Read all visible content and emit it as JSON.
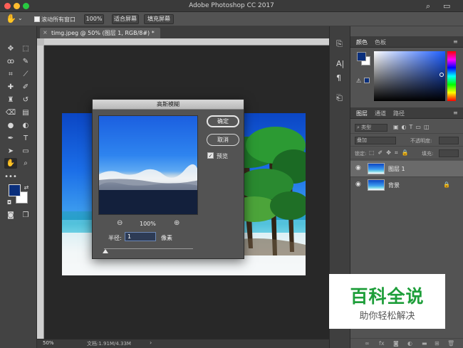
{
  "app": {
    "title": "Adobe Photoshop CC 2017"
  },
  "options": {
    "scroll_all_label": "滚动所有窗口",
    "zoom_100": "100%",
    "fit_screen": "适合屏幕",
    "fill_screen": "填充屏幕"
  },
  "document": {
    "tab_label": "timg.jpeg @ 50% (图层 1, RGB/8#) *",
    "zoom": "50%",
    "doc_size": "文档:1.91M/4.33M"
  },
  "dialog": {
    "title": "高斯模糊",
    "ok": "确定",
    "cancel": "取消",
    "preview_label": "预览",
    "preview_checked": true,
    "zoom_value": "100%",
    "radius_label": "半径:",
    "radius_value": "1",
    "radius_unit": "像素"
  },
  "color_panel": {
    "tabs": [
      "颜色",
      "色板"
    ]
  },
  "layers_panel": {
    "tabs": [
      "图层",
      "通道",
      "路径"
    ],
    "filter_label": "类型",
    "blend_mode": "叠加",
    "opacity_label": "不透明度:",
    "lock_label": "锁定:",
    "fill_label": "填充:",
    "layers": [
      {
        "name": "图层 1",
        "selected": true
      },
      {
        "name": "背景",
        "selected": false
      }
    ]
  },
  "watermark": {
    "main": "百科全说",
    "sub": "助你轻松解决"
  },
  "colors": {
    "foreground": "#0a2f7c",
    "background": "#ffffff",
    "watermark_green": "#1e9e3a"
  }
}
